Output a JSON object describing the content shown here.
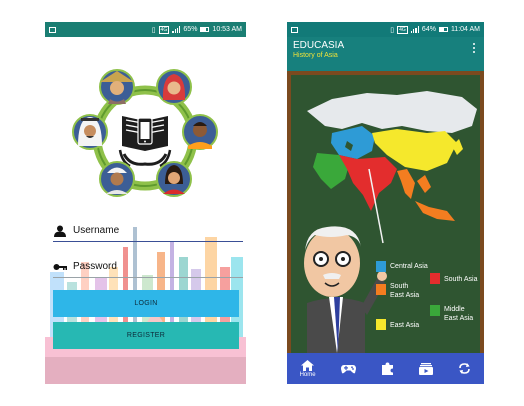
{
  "left_phone": {
    "status_bar": {
      "battery": "65%",
      "time": "10:53 AM",
      "network": "4G"
    },
    "username_placeholder": "Username",
    "password_placeholder": "Password",
    "login_label": "LOGIN",
    "register_label": "REGISTER",
    "icons": [
      "user-icon",
      "key-icon",
      "book-phone-logo"
    ]
  },
  "right_phone": {
    "status_bar": {
      "battery": "64%",
      "time": "11:04 AM",
      "network": "4G"
    },
    "app_title": "EDUCASIA",
    "app_subtitle": "History of Asia",
    "legend": [
      {
        "label": "Central Asia",
        "color": "#2e9bd6"
      },
      {
        "label": "South Asia",
        "color": "#e32d2d"
      },
      {
        "label": "South East Asia",
        "color": "#f47d20"
      },
      {
        "label": "Middle East Asia",
        "color": "#3aa83a"
      },
      {
        "label": "East Asia",
        "color": "#f5e82c"
      }
    ],
    "nav": [
      {
        "label": "Home",
        "icon": "home-icon"
      },
      {
        "label": "",
        "icon": "gamepad-icon"
      },
      {
        "label": "",
        "icon": "puzzle-icon"
      },
      {
        "label": "",
        "icon": "video-icon"
      },
      {
        "label": "",
        "icon": "refresh-icon"
      }
    ]
  },
  "colors": {
    "teal": "#17807d",
    "login_blue": "#2eb6e8",
    "register_teal": "#27b8b3",
    "nav_blue": "#3a56c5",
    "subtitle_yellow": "#f0e23a",
    "board_green": "#2f5531"
  }
}
